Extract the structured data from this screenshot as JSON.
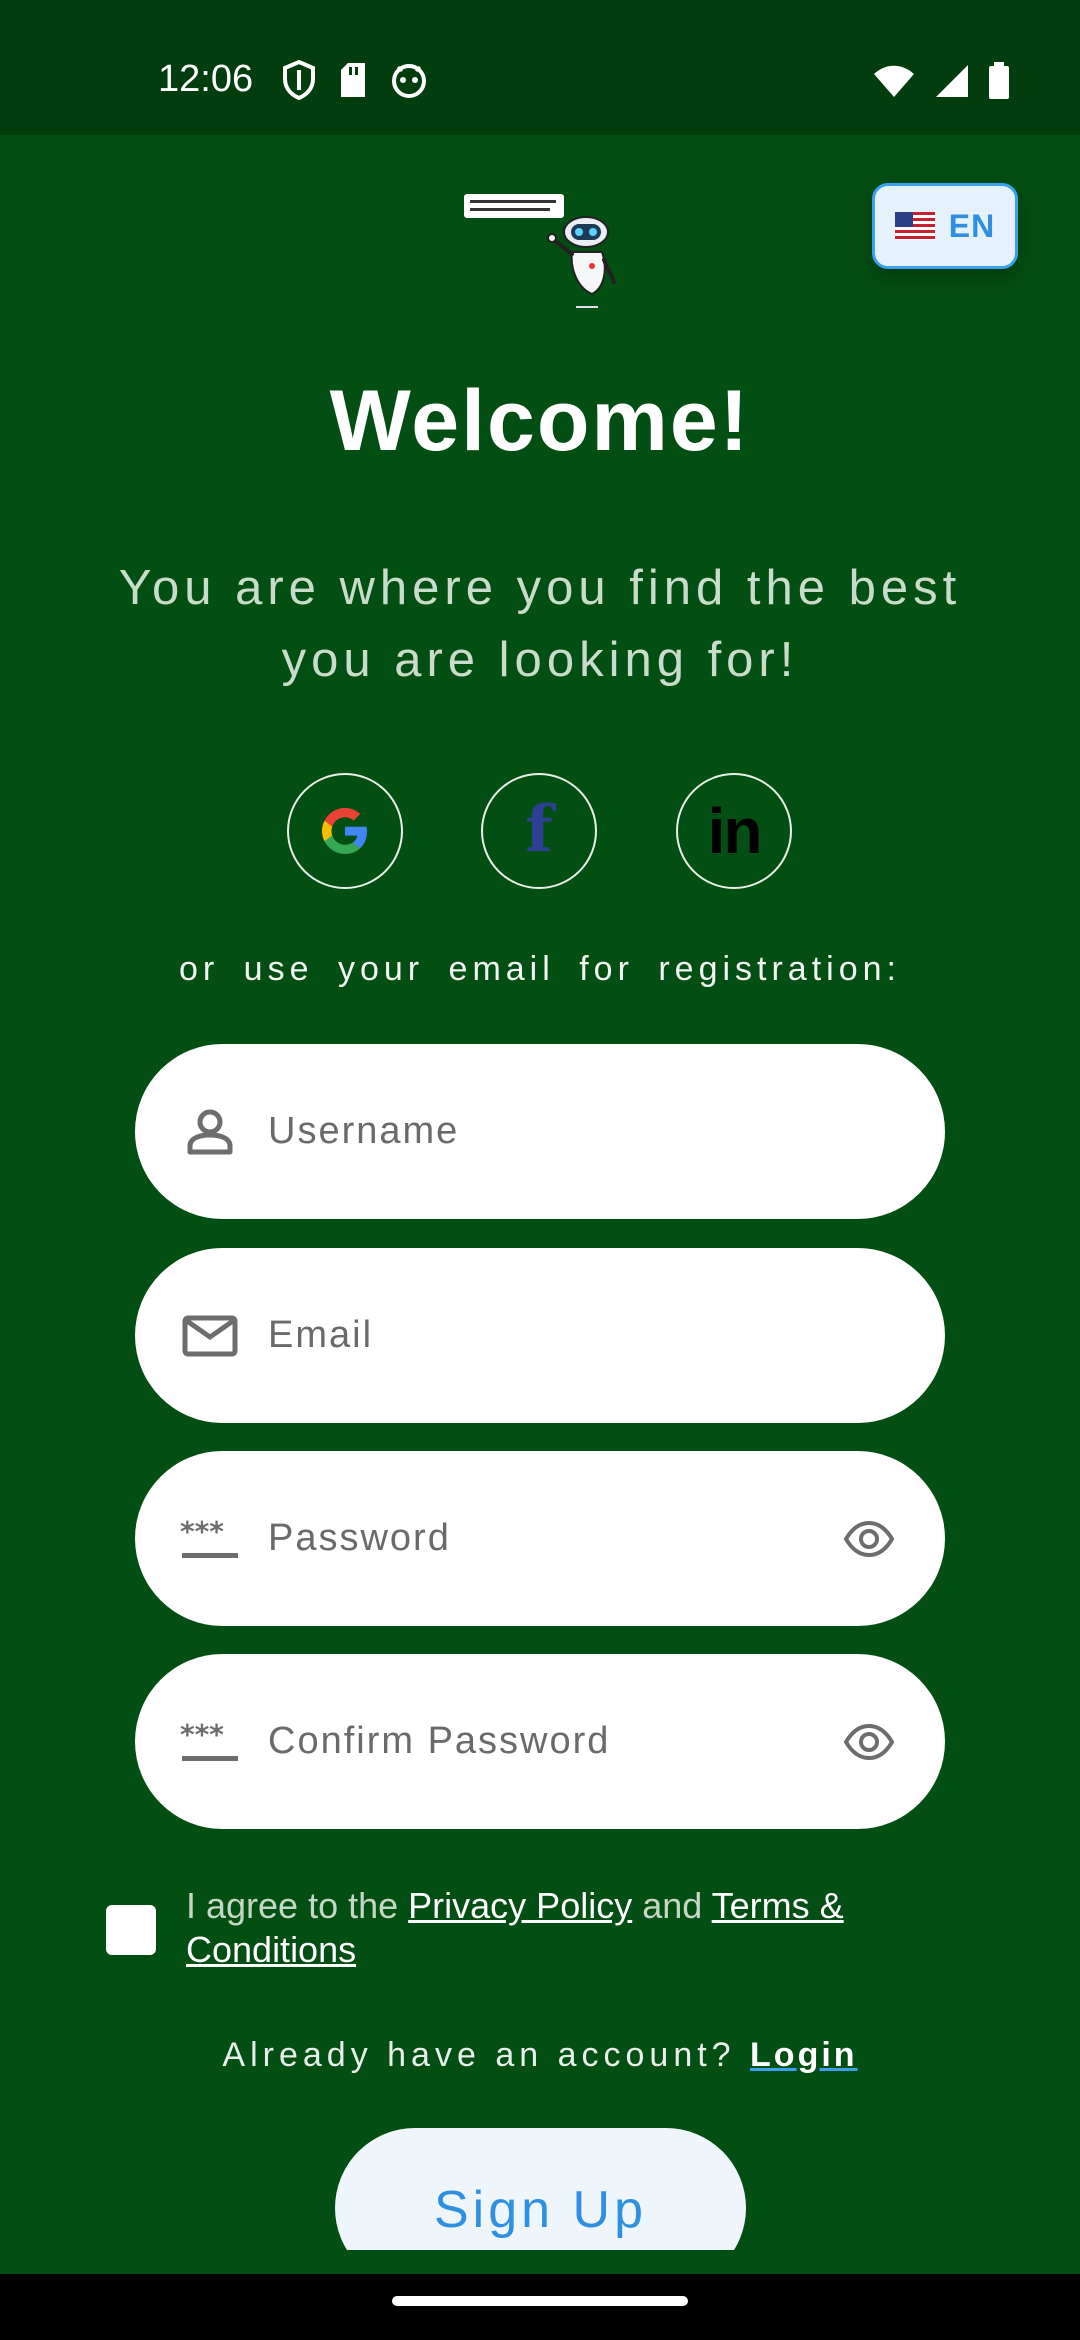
{
  "status_bar": {
    "time": "12:06",
    "left_icons": [
      "shield-icon",
      "sd-card-icon",
      "robot-face-icon"
    ],
    "right_icons": [
      "wifi-icon",
      "signal-icon",
      "battery-icon"
    ]
  },
  "language": {
    "code": "EN",
    "flag": "us-flag-icon"
  },
  "header": {
    "title": "Welcome!",
    "subtitle": "You are where you find the best you are looking for!"
  },
  "social": [
    {
      "name": "google",
      "icon": "google-icon"
    },
    {
      "name": "facebook",
      "icon": "facebook-icon",
      "glyph": "f"
    },
    {
      "name": "linkedin",
      "icon": "linkedin-icon",
      "glyph": "in"
    }
  ],
  "form": {
    "divider_text": "or use your email for registration:",
    "username": {
      "placeholder": "Username",
      "value": ""
    },
    "email": {
      "placeholder": "Email",
      "value": ""
    },
    "password": {
      "placeholder": "Password",
      "value": ""
    },
    "confirm_password": {
      "placeholder": "Confirm Password",
      "value": ""
    }
  },
  "agreement": {
    "prefix": "I agree to the ",
    "privacy_link": "Privacy Policy",
    "middle": " and ",
    "terms_link": "Terms & Conditions",
    "checked": false
  },
  "login": {
    "prompt": "Already have an account? ",
    "link": "Login"
  },
  "signup": {
    "label": "Sign Up"
  },
  "colors": {
    "background": "#034e12",
    "status_bar": "#023d0d",
    "accent": "#2f8fe0",
    "field_bg": "#ffffff"
  }
}
